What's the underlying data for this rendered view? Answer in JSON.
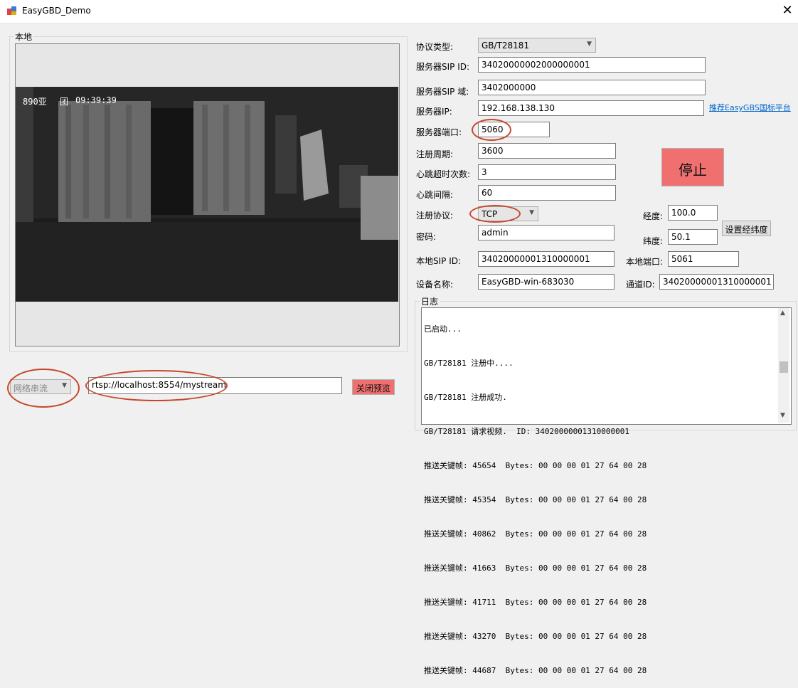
{
  "window": {
    "title": "EasyGBD_Demo"
  },
  "local": {
    "group_label": "本地",
    "osd_left": "890亚",
    "osd_mid": "团",
    "osd_time": "09:39:39"
  },
  "stream": {
    "source_type": "网络串流",
    "url": "rtsp://localhost:8554/mystream",
    "close_preview_label": "关闭预览"
  },
  "config": {
    "protocol_type_label": "协议类型:",
    "protocol_type_value": "GB/T28181",
    "server_sip_id_label": "服务器SIP ID:",
    "server_sip_id_value": "34020000002000000001",
    "server_sip_domain_label": "服务器SIP 域:",
    "server_sip_domain_value": "3402000000",
    "server_ip_label": "服务器IP:",
    "server_ip_value": "192.168.138.130",
    "recommend_link": "推荐EasyGBS国标平台",
    "server_port_label": "服务器端口:",
    "server_port_value": "5060",
    "register_period_label": "注册周期:",
    "register_period_value": "3600",
    "heartbeat_timeout_label": "心跳超时次数:",
    "heartbeat_timeout_value": "3",
    "heartbeat_interval_label": "心跳间隔:",
    "heartbeat_interval_value": "60",
    "register_protocol_label": "注册协议:",
    "register_protocol_value": "TCP",
    "password_label": "密码:",
    "password_value": "admin",
    "local_sip_id_label": "本地SIP ID:",
    "local_sip_id_value": "34020000001310000001",
    "device_name_label": "设备名称:",
    "device_name_value": "EasyGBD-win-683030",
    "longitude_label": "经度:",
    "longitude_value": "100.0",
    "latitude_label": "纬度:",
    "latitude_value": "50.1",
    "set_coords_label": "设置经纬度",
    "local_port_label": "本地端口:",
    "local_port_value": "5061",
    "channel_id_label": "通道ID:",
    "channel_id_value": "34020000001310000001",
    "stop_label": "停止"
  },
  "log": {
    "group_label": "日志",
    "lines": [
      "已启动...",
      "GB/T28181 注册中....",
      "GB/T28181 注册成功.",
      "GB/T28181 请求视频.  ID: 34020000001310000001",
      "推送关键帧: 45654  Bytes: 00 00 00 01 27 64 00 28",
      "推送关键帧: 45354  Bytes: 00 00 00 01 27 64 00 28",
      "推送关键帧: 40862  Bytes: 00 00 00 01 27 64 00 28",
      "推送关键帧: 41663  Bytes: 00 00 00 01 27 64 00 28",
      "推送关键帧: 41711  Bytes: 00 00 00 01 27 64 00 28",
      "推送关键帧: 43270  Bytes: 00 00 00 01 27 64 00 28",
      "推送关键帧: 44687  Bytes: 00 00 00 01 27 64 00 28"
    ]
  }
}
